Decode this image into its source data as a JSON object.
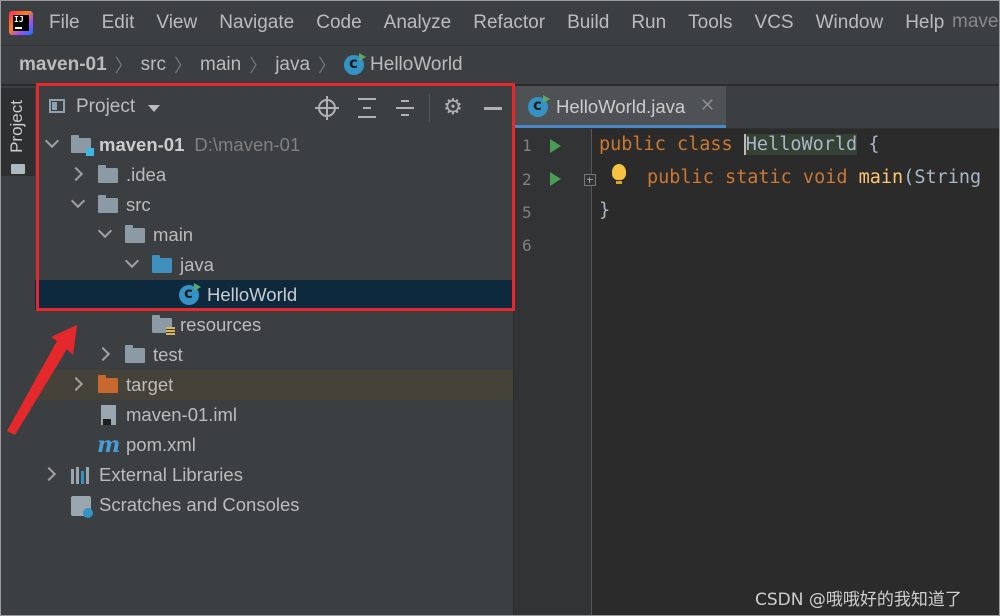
{
  "menubar": {
    "items": [
      "File",
      "Edit",
      "View",
      "Navigate",
      "Code",
      "Analyze",
      "Refactor",
      "Build",
      "Run",
      "Tools",
      "VCS",
      "Window",
      "Help"
    ],
    "project_name_cut": "maven"
  },
  "breadcrumb": {
    "items": [
      "maven-01",
      "src",
      "main",
      "java",
      "HelloWorld"
    ]
  },
  "toolstrip": {
    "project_tab": "Project"
  },
  "project_panel": {
    "title": "Project",
    "tree": [
      {
        "label": "maven-01",
        "sub": "D:\\maven-01"
      },
      {
        "label": ".idea"
      },
      {
        "label": "src"
      },
      {
        "label": "main"
      },
      {
        "label": "java"
      },
      {
        "label": "HelloWorld"
      },
      {
        "label": "resources"
      },
      {
        "label": "test"
      },
      {
        "label": "target"
      },
      {
        "label": "maven-01.iml"
      },
      {
        "label": "pom.xml"
      },
      {
        "label": "External Libraries"
      },
      {
        "label": "Scratches and Consoles"
      }
    ]
  },
  "editor": {
    "tab_label": "HelloWorld.java",
    "line_numbers": [
      "1",
      "2",
      "5",
      "6"
    ],
    "code": {
      "l1_kw": "public class ",
      "l1_cls": "HelloWorld",
      "l1_rest": " {",
      "l2_kw": "public static void ",
      "l2_fn": "main",
      "l2_rest": "(String",
      "l3": "}"
    }
  },
  "watermark": "CSDN @哦哦好的我知道了",
  "colors": {
    "annotation": "#e5282b",
    "selected_row": "#0d293e",
    "keyword": "#cc7832"
  }
}
